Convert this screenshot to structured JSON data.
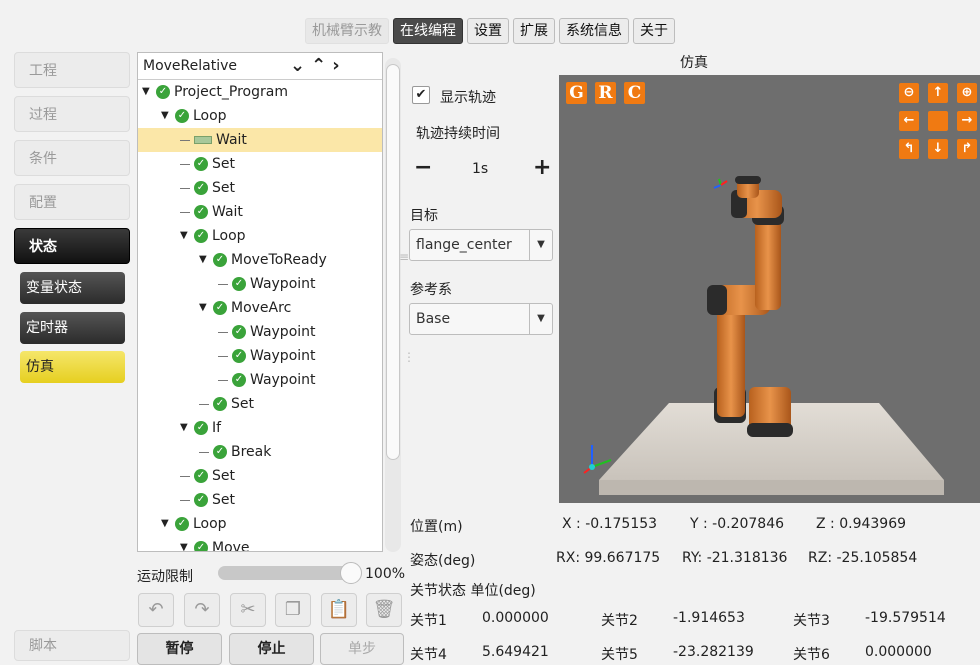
{
  "top_menu": {
    "teach": "机械臂示教",
    "online_programming": "在线编程",
    "settings": "设置",
    "extensions": "扩展",
    "system_info": "系统信息",
    "about": "关于"
  },
  "left_nav": {
    "project": "工程",
    "process": "过程",
    "condition": "条件",
    "config": "配置",
    "status": "状态",
    "sub": {
      "variable_status": "变量状态",
      "timer": "定时器",
      "simulation": "仿真"
    },
    "script": "脚本"
  },
  "tree": {
    "header": "MoveRelative",
    "items": [
      {
        "label": "Project_Program"
      },
      {
        "label": "Loop"
      },
      {
        "label": "Wait"
      },
      {
        "label": "Set"
      },
      {
        "label": "Set"
      },
      {
        "label": "Wait"
      },
      {
        "label": "Loop"
      },
      {
        "label": "MoveToReady"
      },
      {
        "label": "Waypoint"
      },
      {
        "label": "MoveArc"
      },
      {
        "label": "Waypoint"
      },
      {
        "label": "Waypoint"
      },
      {
        "label": "Waypoint"
      },
      {
        "label": "Set"
      },
      {
        "label": "If"
      },
      {
        "label": "Break"
      },
      {
        "label": "Set"
      },
      {
        "label": "Set"
      },
      {
        "label": "Loop"
      },
      {
        "label": "Move"
      }
    ]
  },
  "motion_limit": {
    "label": "运动限制",
    "value": "100%",
    "fraction": 1.0
  },
  "controls": {
    "pause": "暂停",
    "stop": "停止",
    "step": "单步"
  },
  "sim": {
    "title": "仿真",
    "show_trajectory": "显示轨迹",
    "trajectory_duration_label": "轨迹持续时间",
    "duration_value": "1s",
    "minus": "−",
    "plus": "+",
    "target_label": "目标",
    "target_value": "flange_center",
    "ref_label": "参考系",
    "ref_value": "Base",
    "view_letters": [
      "G",
      "R",
      "C"
    ]
  },
  "readout": {
    "position_label": "位置(m)",
    "x": "X : -0.175153",
    "y": "Y : -0.207846",
    "z": "Z : 0.943969",
    "pose_label": "姿态(deg)",
    "rx": "RX: 99.667175",
    "ry": "RY: -21.318136",
    "rz": "RZ: -25.105854",
    "joint_status_label": "关节状态 单位(deg)",
    "joints": [
      {
        "name": "关节1",
        "value": "0.000000"
      },
      {
        "name": "关节2",
        "value": "-1.914653"
      },
      {
        "name": "关节3",
        "value": "-19.579514"
      },
      {
        "name": "关节4",
        "value": "5.649421"
      },
      {
        "name": "关节5",
        "value": "-23.282139"
      },
      {
        "name": "关节6",
        "value": "0.000000"
      }
    ]
  },
  "colors": {
    "accent": "#f07a12",
    "selected_row": "#fbe7a8",
    "check_green": "#3aa33a"
  }
}
